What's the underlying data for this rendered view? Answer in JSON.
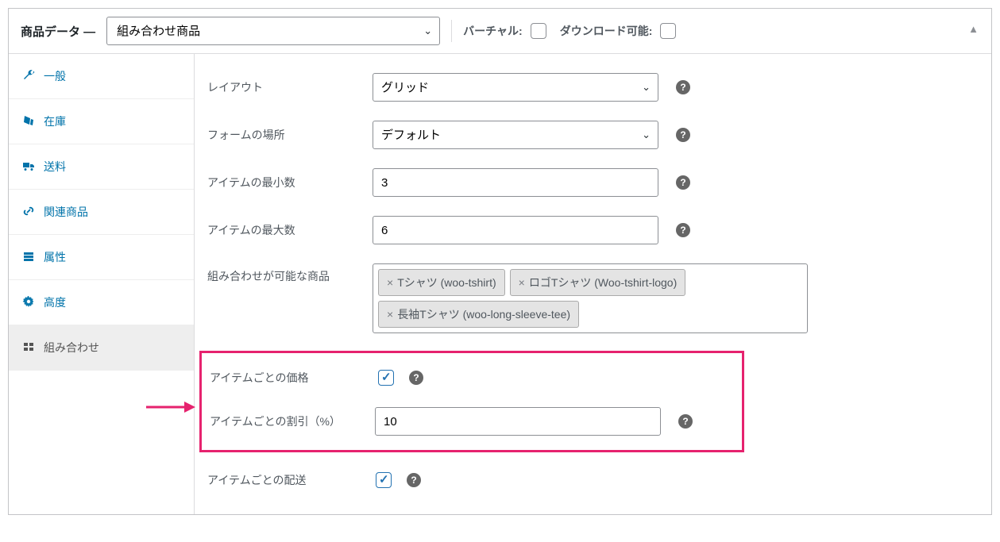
{
  "header": {
    "title": "商品データ —",
    "product_type": "組み合わせ商品",
    "virtual_label": "バーチャル:",
    "downloadable_label": "ダウンロード可能:"
  },
  "sidebar": {
    "items": [
      {
        "icon": "wrench",
        "label": "一般"
      },
      {
        "icon": "stock",
        "label": "在庫"
      },
      {
        "icon": "truck",
        "label": "送料"
      },
      {
        "icon": "link",
        "label": "関連商品"
      },
      {
        "icon": "list",
        "label": "属性"
      },
      {
        "icon": "gear",
        "label": "高度"
      },
      {
        "icon": "grid",
        "label": "組み合わせ"
      }
    ]
  },
  "form": {
    "layout_label": "レイアウト",
    "layout_value": "グリッド",
    "form_location_label": "フォームの場所",
    "form_location_value": "デフォルト",
    "min_label": "アイテムの最小数",
    "min_value": "3",
    "max_label": "アイテムの最大数",
    "max_value": "6",
    "products_label": "組み合わせが可能な商品",
    "tags": [
      "Tシャツ (woo-tshirt)",
      "ロゴTシャツ (Woo-tshirt-logo)",
      "長袖Tシャツ (woo-long-sleeve-tee)"
    ],
    "per_item_price_label": "アイテムごとの価格",
    "per_item_discount_label": "アイテムごとの割引（%）",
    "per_item_discount_value": "10",
    "per_item_shipping_label": "アイテムごとの配送"
  }
}
